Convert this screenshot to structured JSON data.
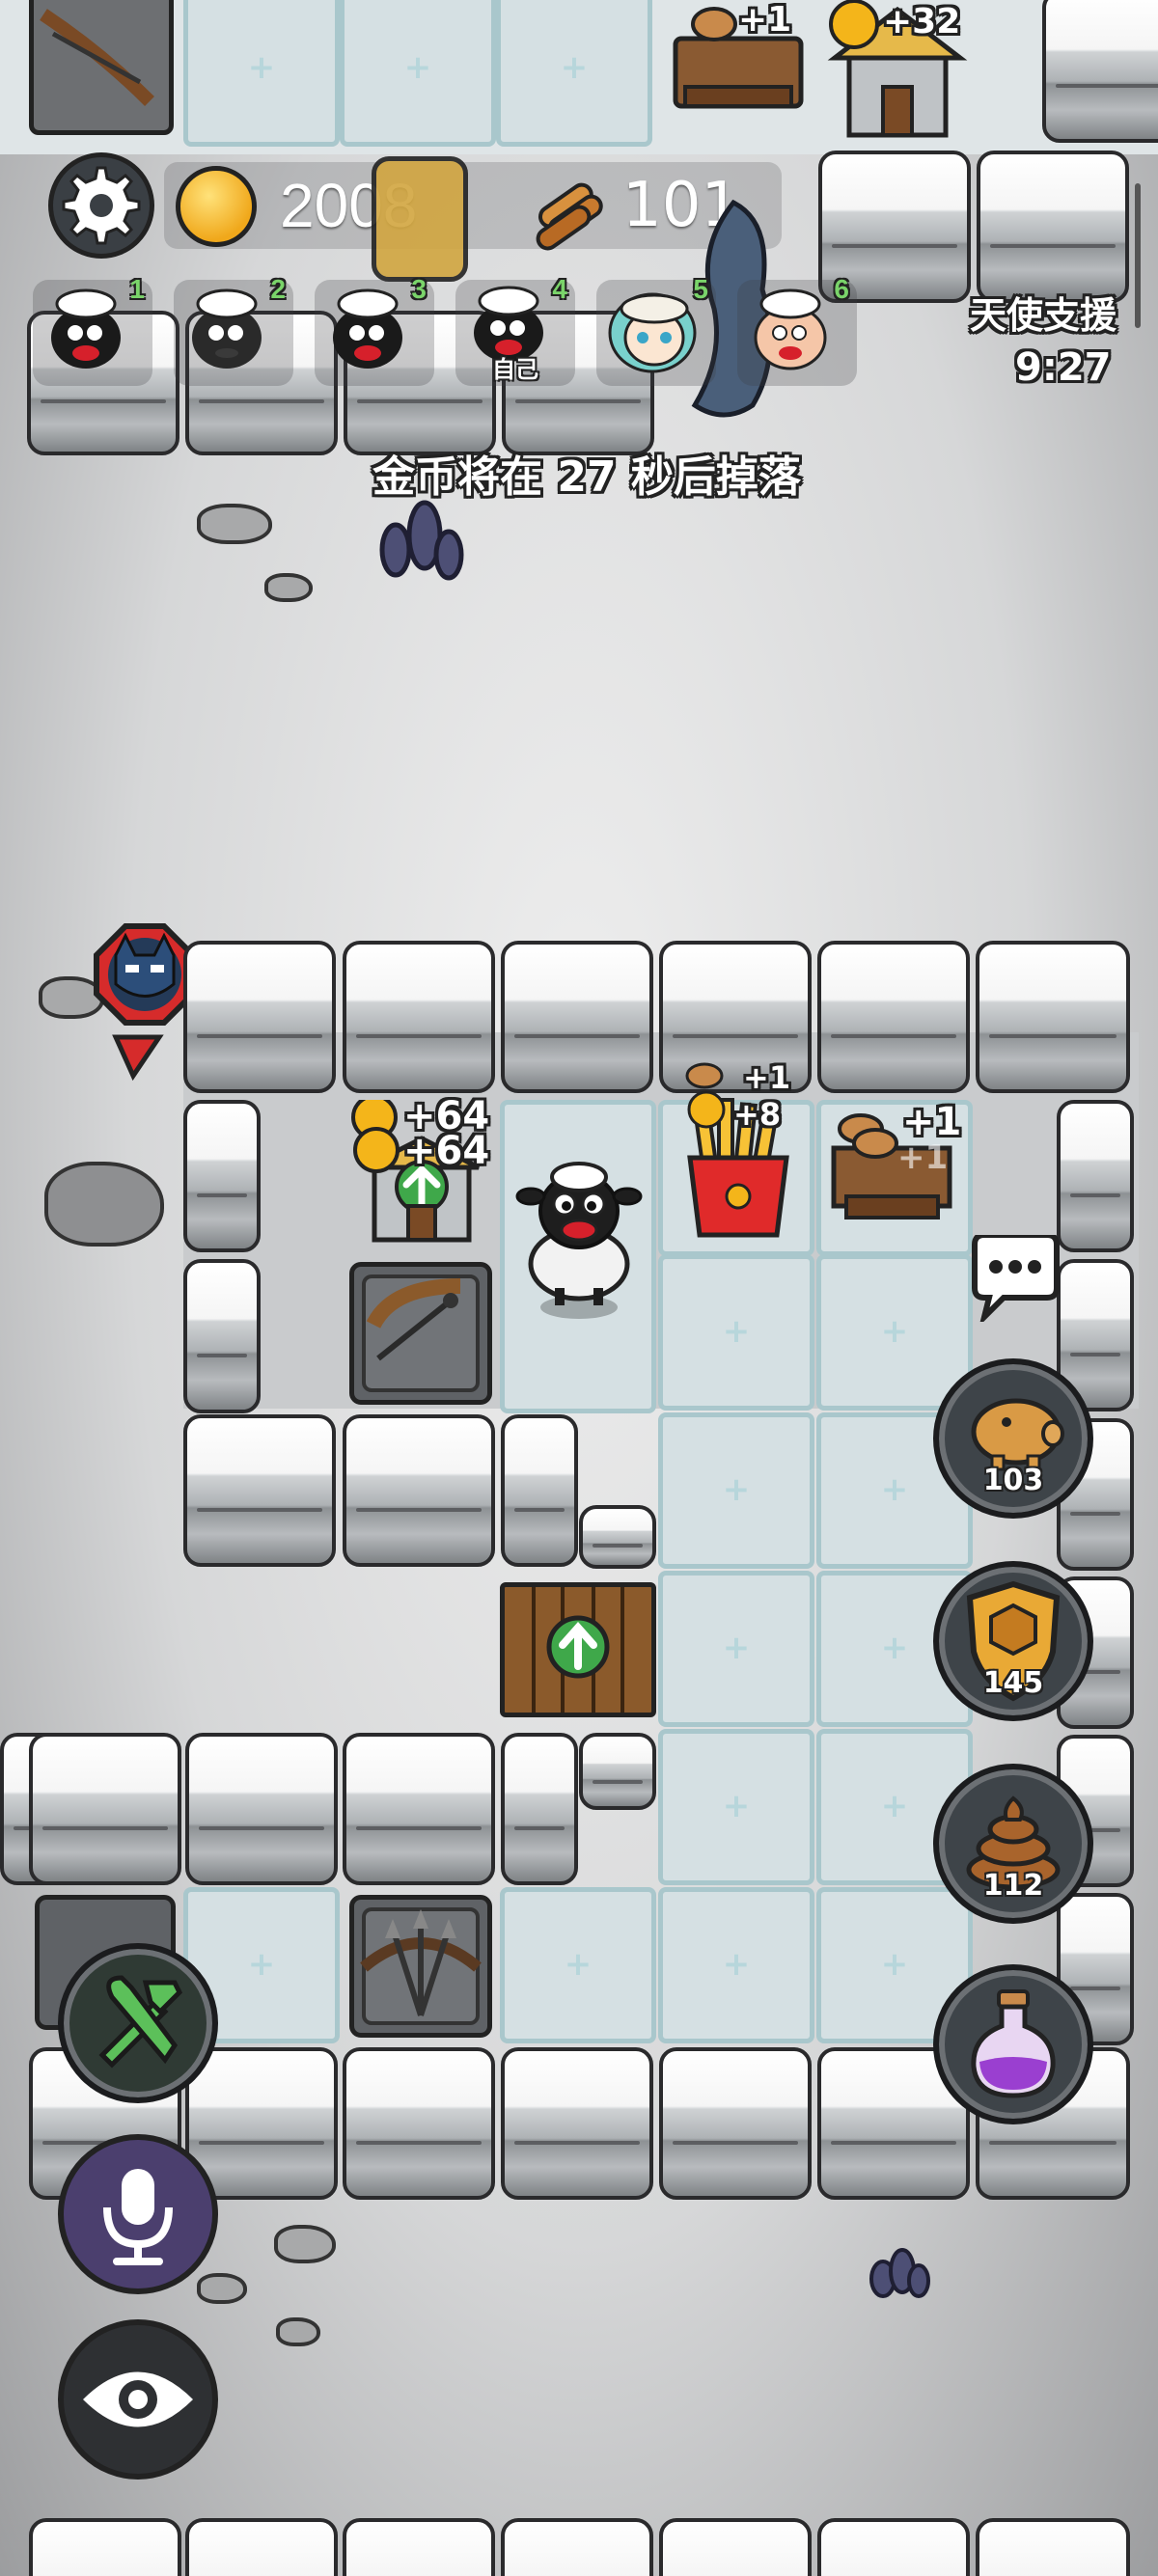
{
  "hud": {
    "gold": "2008",
    "wood": "101",
    "settings_icon": "gear-icon",
    "gold_icon": "gold-coin-icon",
    "wood_icon": "wood-logs-icon"
  },
  "players": [
    {
      "slot": "1",
      "label": ""
    },
    {
      "slot": "2",
      "label": ""
    },
    {
      "slot": "3",
      "label": ""
    },
    {
      "slot": "4",
      "label": "自己"
    },
    {
      "slot": "5",
      "label": ""
    },
    {
      "slot": "6",
      "label": ""
    }
  ],
  "angel_support": {
    "title": "天使支援",
    "timer": "9:27"
  },
  "announcement": "金币将在 27 秒后掉落",
  "top_income": {
    "wood": "+1",
    "gold": "+32"
  },
  "room_income": {
    "gold_house_a": "+64",
    "gold_house_b": "+64",
    "fries_wood": "+1",
    "fries_gold": "+8",
    "sawmill_a": "+1",
    "sawmill_b": "+1"
  },
  "abilities": [
    {
      "name": "piggy-bank",
      "count": "103"
    },
    {
      "name": "shield",
      "count": "145"
    },
    {
      "name": "poop",
      "count": "112"
    },
    {
      "name": "potion",
      "count": ""
    }
  ],
  "left_buttons": [
    "build-tools",
    "microphone",
    "eye"
  ],
  "colors": {
    "accent_green": "#3fa84a",
    "gold": "#f4b51a",
    "bubble_white": "#ffffff"
  }
}
